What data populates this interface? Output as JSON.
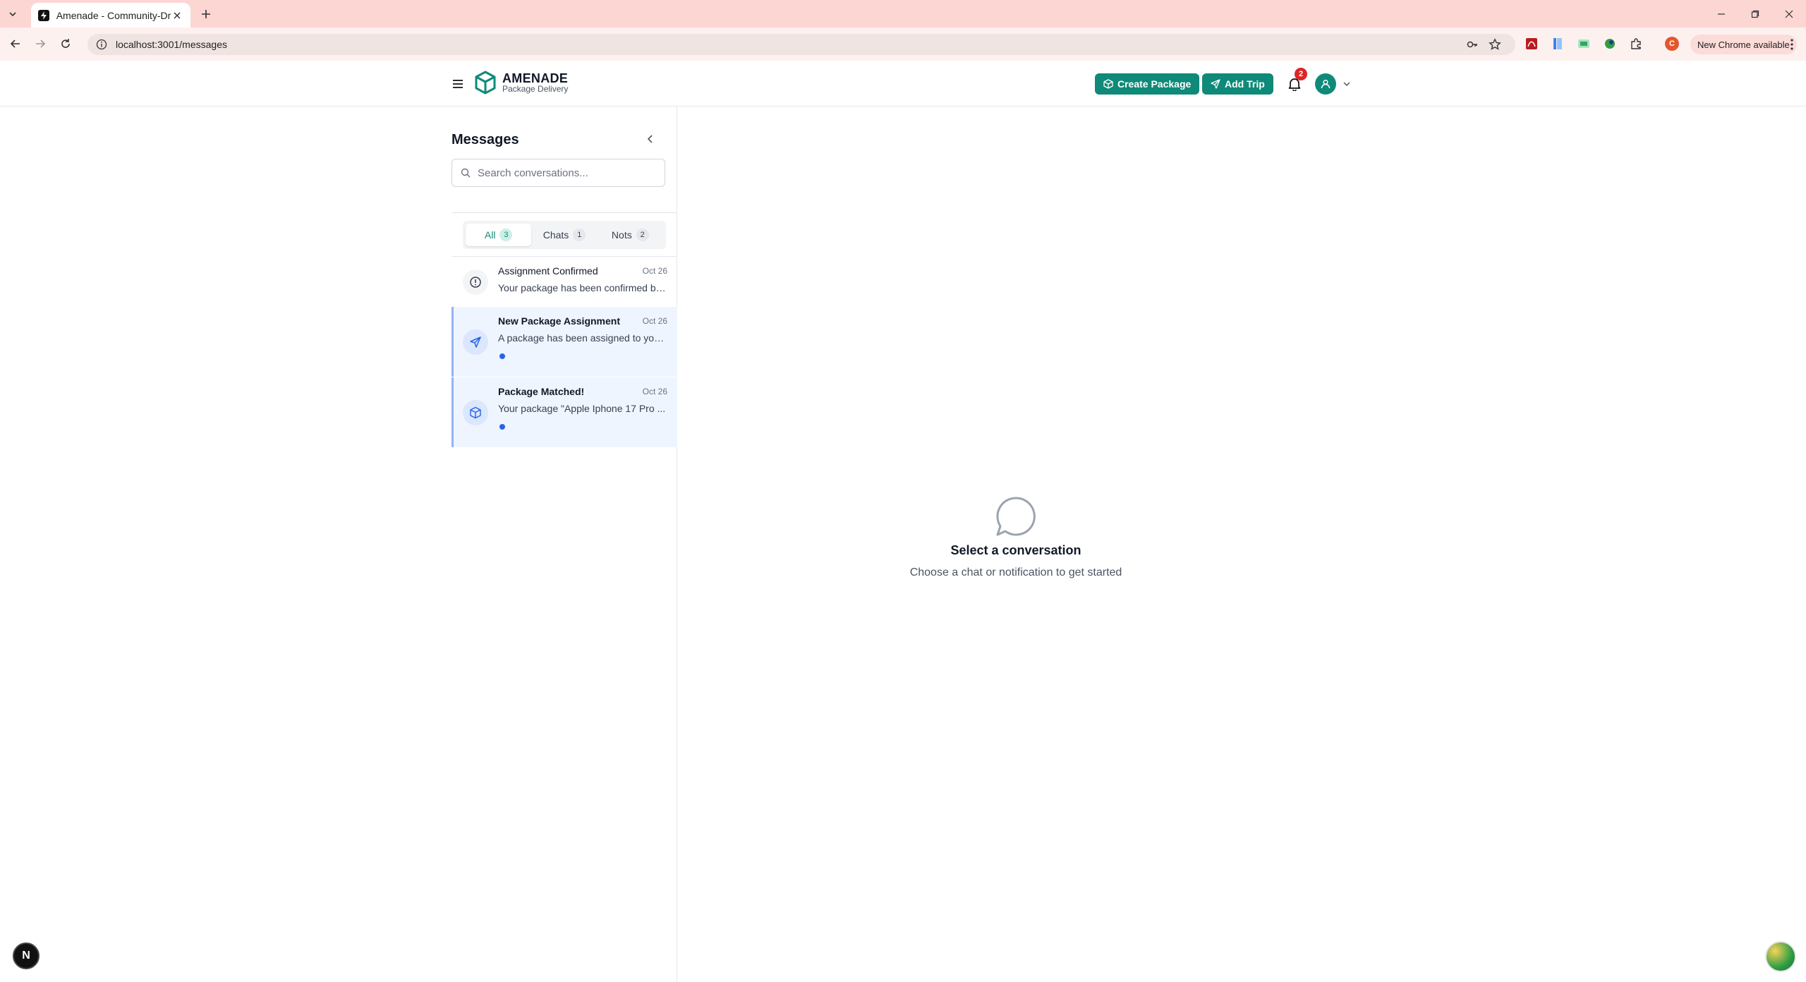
{
  "browser": {
    "tab_title": "Amenade - Community-Driven",
    "url": "localhost:3001/messages",
    "update_label": "New Chrome available",
    "profile_initial": "C"
  },
  "header": {
    "brand": "AMENADE",
    "tagline": "Package Delivery",
    "create_package_label": "Create Package",
    "add_trip_label": "Add Trip",
    "notification_count": "2",
    "accent_color": "#0f8a78"
  },
  "sidebar": {
    "title": "Messages",
    "search_placeholder": "Search conversations...",
    "tabs": [
      {
        "label": "All",
        "count": "3",
        "active": true
      },
      {
        "label": "Chats",
        "count": "1",
        "active": false
      },
      {
        "label": "Nots",
        "count": "2",
        "active": false
      }
    ],
    "conversations": [
      {
        "title": "Assignment Confirmed",
        "date": "Oct 26",
        "preview": "Your package has been confirmed by...",
        "icon": "alert-circle-icon",
        "unread": false
      },
      {
        "title": "New Package Assignment",
        "date": "Oct 26",
        "preview": "A package has been assigned to you...",
        "icon": "plane-icon",
        "unread": true
      },
      {
        "title": "Package Matched!",
        "date": "Oct 26",
        "preview": "Your package \"Apple Iphone 17 Pro ...",
        "icon": "package-icon",
        "unread": true
      }
    ]
  },
  "empty_state": {
    "title": "Select a conversation",
    "subtitle": "Choose a chat or notification to get started"
  },
  "dev_badge": "N"
}
